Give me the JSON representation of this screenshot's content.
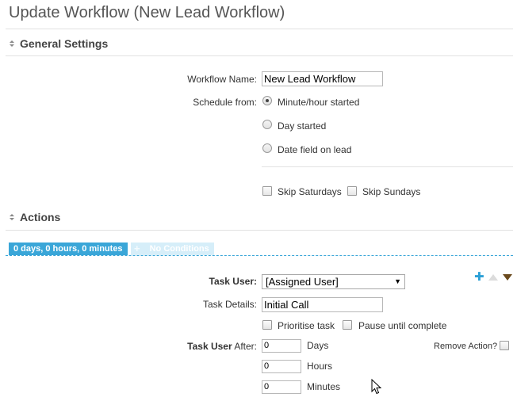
{
  "page": {
    "title": "Update Workflow (New Lead Workflow)"
  },
  "general_settings": {
    "header": "General Settings",
    "workflow_name": {
      "label": "Workflow Name:",
      "value": "New Lead Workflow"
    },
    "schedule_from": {
      "label": "Schedule from:",
      "options": [
        {
          "label": "Minute/hour started",
          "checked": true
        },
        {
          "label": "Day started",
          "checked": false
        },
        {
          "label": "Date field on lead",
          "checked": false
        }
      ]
    },
    "skip": [
      {
        "label": "Skip Saturdays",
        "checked": false
      },
      {
        "label": "Skip Sundays",
        "checked": false
      }
    ]
  },
  "actions": {
    "header": "Actions",
    "tabs": [
      {
        "label": "0 days, 0 hours, 0 minutes",
        "active": true
      },
      {
        "label": "No Conditions",
        "active": false
      }
    ],
    "task_user": {
      "label": "Task User:",
      "value": "[Assigned User]"
    },
    "task_details": {
      "label": "Task Details:",
      "value": "Initial Call"
    },
    "flags": [
      {
        "label": "Prioritise task",
        "checked": false
      },
      {
        "label": "Pause until complete",
        "checked": false
      }
    ],
    "task_user_after": {
      "label_bold": "Task User",
      "label_rest": " After:",
      "days": {
        "value": "0",
        "unit": "Days"
      },
      "hours": {
        "value": "0",
        "unit": "Hours"
      },
      "minutes": {
        "value": "0",
        "unit": "Minutes"
      }
    },
    "remove_action": {
      "label": "Remove Action?",
      "checked": false
    },
    "icons": {
      "add": "plus-icon",
      "up": "arrow-up-icon",
      "down": "arrow-down-icon"
    }
  },
  "colors": {
    "tab_active": "#3aa6d8",
    "tab_inactive": "#d6eef9",
    "add_icon": "#2b9fd6",
    "down_icon": "#6b4a1e"
  }
}
